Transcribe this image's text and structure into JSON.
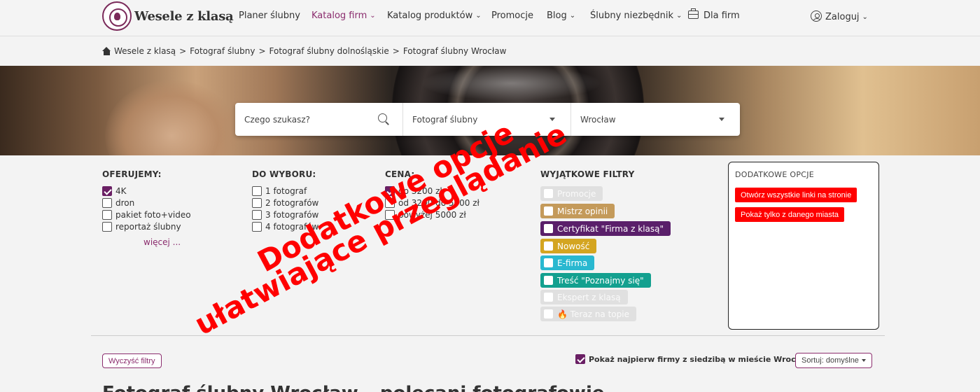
{
  "brand": {
    "name": "Wesele z klasą"
  },
  "nav": {
    "planner": "Planer ślubny",
    "catalog_firms": "Katalog firm",
    "catalog_products": "Katalog produktów",
    "promotions": "Promocje",
    "blog": "Blog",
    "essentials": "Ślubny niezbędnik",
    "for_firms": "Dla firm",
    "login": "Zaloguj"
  },
  "breadcrumb": [
    "Wesele z klasą",
    "Fotograf ślubny",
    "Fotograf ślubny dolnośląskie",
    "Fotograf ślubny Wrocław"
  ],
  "search": {
    "query_placeholder": "Czego szukasz?",
    "category": "Fotograf ślubny",
    "city": "Wrocław"
  },
  "filters": {
    "offer": {
      "title": "OFERUJEMY:",
      "options": [
        {
          "label": "4K",
          "checked": true
        },
        {
          "label": "dron",
          "checked": false
        },
        {
          "label": "pakiet foto+video",
          "checked": false
        },
        {
          "label": "reportaż ślubny",
          "checked": false
        }
      ],
      "more": "więcej ..."
    },
    "choice": {
      "title": "DO WYBORU:",
      "options": [
        {
          "label": "1 fotograf",
          "checked": false
        },
        {
          "label": "2 fotografów",
          "checked": false
        },
        {
          "label": "3 fotografów",
          "checked": false
        },
        {
          "label": "4 fotografów",
          "checked": false
        }
      ]
    },
    "price": {
      "title": "CENA:",
      "options": [
        {
          "label": "do 3200 zł",
          "checked": false
        },
        {
          "label": "od 3200 do 5000 zł",
          "checked": true
        },
        {
          "label": "powyżej 5000 zł",
          "checked": false
        }
      ]
    },
    "special": {
      "title": "WYJĄTKOWE FILTRY",
      "badges": [
        {
          "label": "Promocje",
          "color": "#e0e0e0"
        },
        {
          "label": "Mistrz opinii",
          "color": "#c49a5a"
        },
        {
          "label": "Certyfikat \"Firma z klasą\"",
          "color": "#5a1f6a"
        },
        {
          "label": "Nowość",
          "color": "#d4a520"
        },
        {
          "label": "E-firma",
          "color": "#29b8d0"
        },
        {
          "label": "Treść \"Poznajmy się\"",
          "color": "#13a08f"
        },
        {
          "label": "Ekspert z klasą",
          "color": "#e0e0e0"
        },
        {
          "label": "🔥 Teraz na topie",
          "color": "#e0e0e0"
        }
      ]
    }
  },
  "extra_options": {
    "title": "DODATKOWE OPCJE",
    "open_all_links": "Otwórz wszystkie linki na stronie",
    "only_city": "Pokaż tylko z danego miasta"
  },
  "toolbar": {
    "clear_filters": "Wyczyść filtry",
    "show_first_local": "Pokaż najpierw firmy z siedzibą w mieście Wrocław",
    "show_first_local_checked": true,
    "sort": "Sortuj: domyślne"
  },
  "results_heading": "Fotograf ślubny Wrocław – polecani fotografowie",
  "stamp": {
    "line1": "Dodatkowe opcje",
    "line2": "ułatwiające przeglądanie",
    "color": "#ff0000"
  },
  "colors": {
    "accent": "#8b2d6e",
    "checkbox": "#6a1f64"
  }
}
